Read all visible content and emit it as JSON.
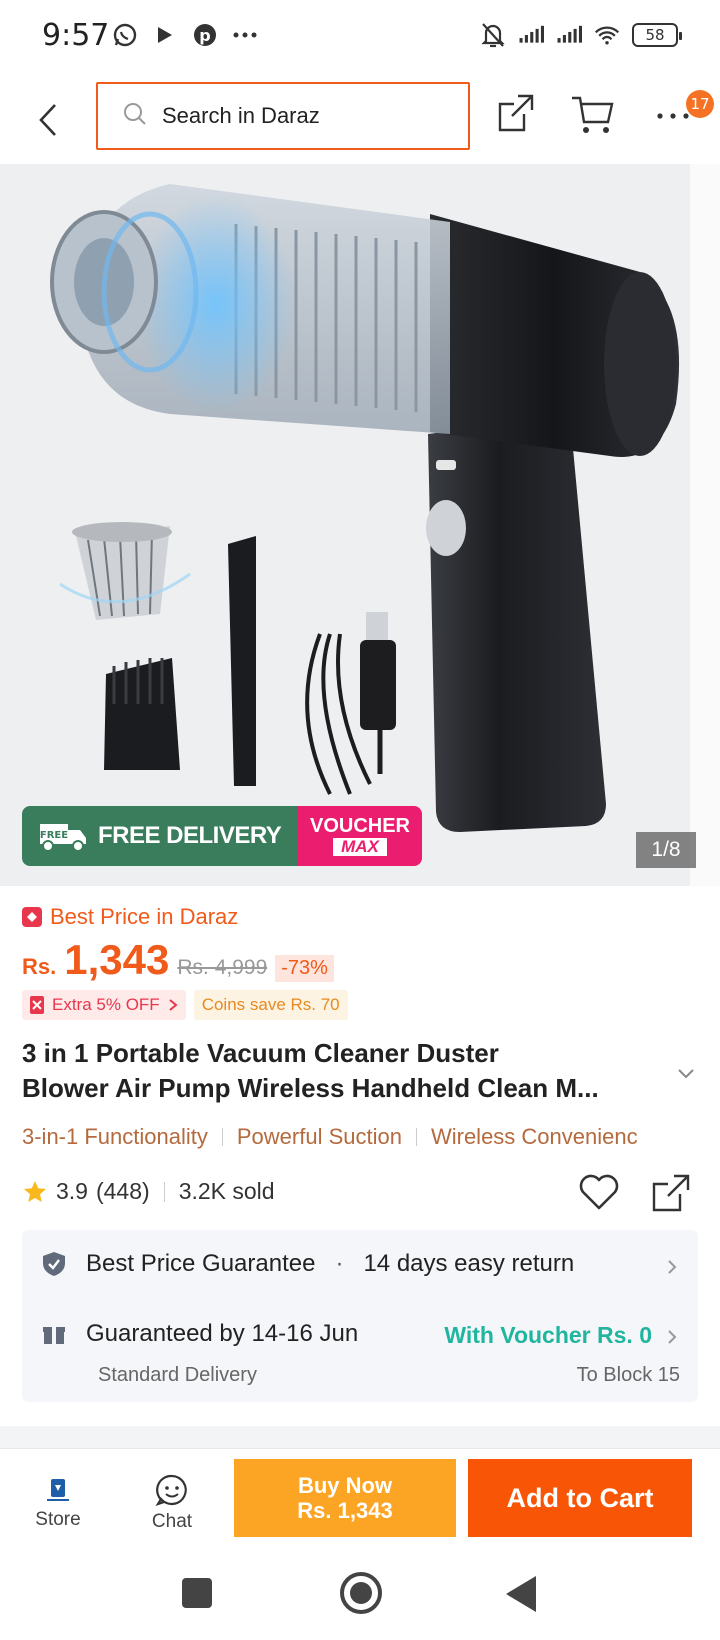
{
  "status": {
    "time": "9:57",
    "battery": "58"
  },
  "nav": {
    "search_placeholder": "Search in Daraz",
    "cart_badge": "17",
    "more": "⋯"
  },
  "hero": {
    "promo_free": "FREE DELIVERY",
    "promo_free_tag": "FREE",
    "promo_voucher_1": "VOUCHER",
    "promo_voucher_2": "MAX",
    "image_counter": "1/8"
  },
  "price": {
    "best_price_label": "Best Price in Daraz",
    "currency": "Rs.",
    "current": "1,343",
    "original": "Rs. 4,999",
    "discount": "-73%",
    "extra_offer": "Extra 5% OFF",
    "coins_offer": "Coins save Rs. 70"
  },
  "product": {
    "title_line1": "3 in 1 Portable Vacuum Cleaner Duster",
    "title_line2": "Blower Air Pump Wireless Handheld Clean M...",
    "features": [
      "3-in-1 Functionality",
      "Powerful Suction",
      "Wireless Convenienc"
    ],
    "rating": "3.9",
    "reviews": "(448)",
    "sold": "3.2K sold"
  },
  "service": {
    "guarantee": "Best Price Guarantee",
    "dot": "·",
    "returns": "14 days easy return",
    "delivery_eta": "Guaranteed by 14-16 Jun",
    "voucher": "With Voucher Rs. 0",
    "delivery_type": "Standard Delivery",
    "destination": "To Block 15"
  },
  "actions": {
    "store": "Store",
    "chat": "Chat",
    "buy_now_line1": "Buy Now",
    "buy_now_line2": "Rs. 1,343",
    "add_to_cart": "Add to Cart"
  },
  "colors": {
    "brand_orange": "#f85606",
    "buy_now": "#fca524",
    "voucher_green": "#1fb59f",
    "delivery_green": "#3a7d5d",
    "voucher_pink": "#ea1d6e"
  }
}
